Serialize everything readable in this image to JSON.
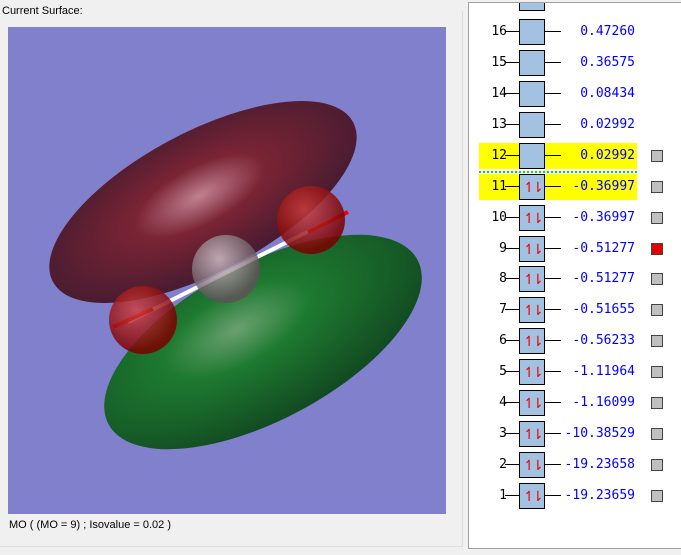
{
  "label": "Current Surface:",
  "status": "MO ( (MO = 9) ; Isovalue = 0.02 )",
  "orbitals": [
    {
      "n": "16",
      "e": "0.47260",
      "occ": false,
      "check": false
    },
    {
      "n": "15",
      "e": "0.36575",
      "occ": false,
      "check": false
    },
    {
      "n": "14",
      "e": "0.08434",
      "occ": false,
      "check": false
    },
    {
      "n": "13",
      "e": "0.02992",
      "occ": false,
      "check": false
    },
    {
      "n": "12",
      "e": "0.02992",
      "occ": false,
      "check": "gray",
      "hl": true
    },
    {
      "n": "11",
      "e": "-0.36997",
      "occ": true,
      "check": "gray",
      "hl": true
    },
    {
      "n": "10",
      "e": "-0.36997",
      "occ": true,
      "check": "gray"
    },
    {
      "n": "9",
      "e": "-0.51277",
      "occ": true,
      "check": "red"
    },
    {
      "n": "8",
      "e": "-0.51277",
      "occ": true,
      "check": "gray"
    },
    {
      "n": "7",
      "e": "-0.51655",
      "occ": true,
      "check": "gray"
    },
    {
      "n": "6",
      "e": "-0.56233",
      "occ": true,
      "check": "gray"
    },
    {
      "n": "5",
      "e": "-1.11964",
      "occ": true,
      "check": "gray"
    },
    {
      "n": "4",
      "e": "-1.16099",
      "occ": true,
      "check": "gray"
    },
    {
      "n": "3",
      "e": "-10.38529",
      "occ": true,
      "check": "gray"
    },
    {
      "n": "2",
      "e": "-19.23658",
      "occ": true,
      "check": "gray"
    },
    {
      "n": "1",
      "e": "-19.23659",
      "occ": true,
      "check": "gray"
    }
  ],
  "occ_symbol": "↿⇂"
}
